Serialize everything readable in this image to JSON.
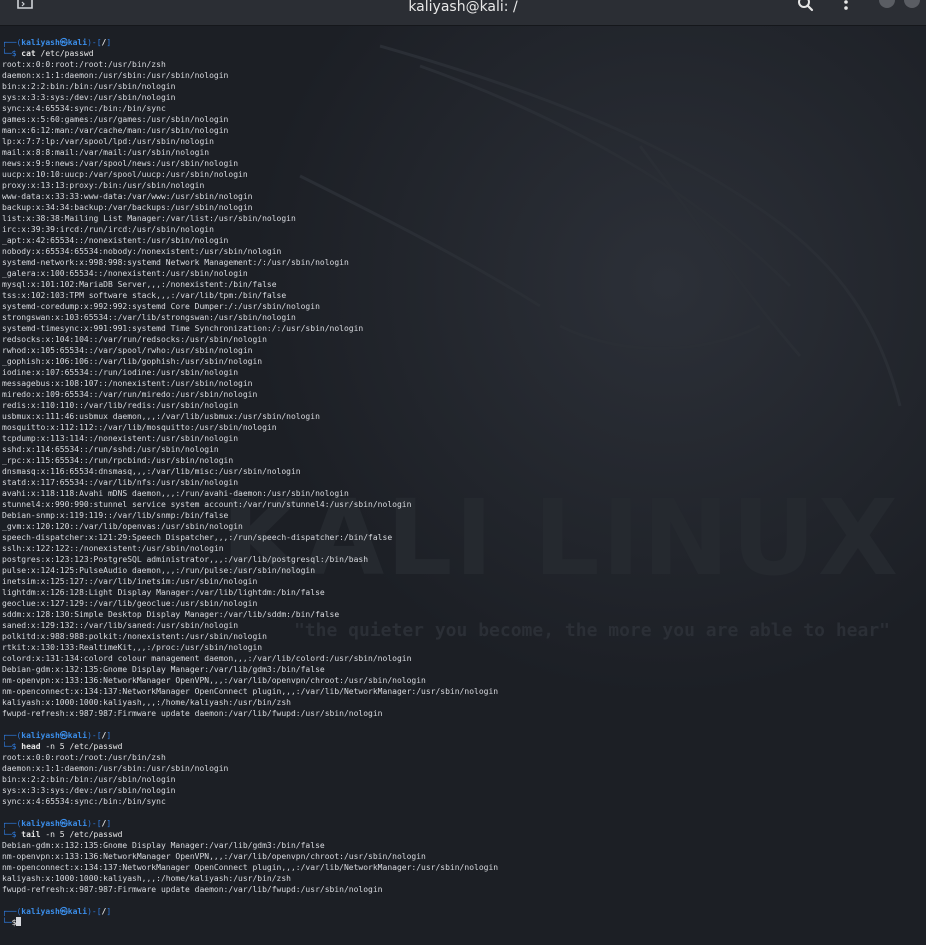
{
  "window": {
    "title": "kaliyash@kali: /",
    "buttons": [
      "search-icon",
      "kebab-menu-icon",
      "minimize",
      "close"
    ]
  },
  "wallpaper": {
    "logo_text": "KALI LINUX",
    "tagline": "\"the quieter you become, the more you are able to hear\""
  },
  "prompt": {
    "user": "kaliyash",
    "symbol": "㉿",
    "host": "kali",
    "cwd": "/"
  },
  "sessions": [
    {
      "command": "cat",
      "args": "/etc/passwd",
      "output": [
        "root:x:0:0:root:/root:/usr/bin/zsh",
        "daemon:x:1:1:daemon:/usr/sbin:/usr/sbin/nologin",
        "bin:x:2:2:bin:/bin:/usr/sbin/nologin",
        "sys:x:3:3:sys:/dev:/usr/sbin/nologin",
        "sync:x:4:65534:sync:/bin:/bin/sync",
        "games:x:5:60:games:/usr/games:/usr/sbin/nologin",
        "man:x:6:12:man:/var/cache/man:/usr/sbin/nologin",
        "lp:x:7:7:lp:/var/spool/lpd:/usr/sbin/nologin",
        "mail:x:8:8:mail:/var/mail:/usr/sbin/nologin",
        "news:x:9:9:news:/var/spool/news:/usr/sbin/nologin",
        "uucp:x:10:10:uucp:/var/spool/uucp:/usr/sbin/nologin",
        "proxy:x:13:13:proxy:/bin:/usr/sbin/nologin",
        "www-data:x:33:33:www-data:/var/www:/usr/sbin/nologin",
        "backup:x:34:34:backup:/var/backups:/usr/sbin/nologin",
        "list:x:38:38:Mailing List Manager:/var/list:/usr/sbin/nologin",
        "irc:x:39:39:ircd:/run/ircd:/usr/sbin/nologin",
        "_apt:x:42:65534::/nonexistent:/usr/sbin/nologin",
        "nobody:x:65534:65534:nobody:/nonexistent:/usr/sbin/nologin",
        "systemd-network:x:998:998:systemd Network Management:/:/usr/sbin/nologin",
        "_galera:x:100:65534::/nonexistent:/usr/sbin/nologin",
        "mysql:x:101:102:MariaDB Server,,,:/nonexistent:/bin/false",
        "tss:x:102:103:TPM software stack,,,:/var/lib/tpm:/bin/false",
        "systemd-coredump:x:992:992:systemd Core Dumper:/:/usr/sbin/nologin",
        "strongswan:x:103:65534::/var/lib/strongswan:/usr/sbin/nologin",
        "systemd-timesync:x:991:991:systemd Time Synchronization:/:/usr/sbin/nologin",
        "redsocks:x:104:104::/var/run/redsocks:/usr/sbin/nologin",
        "rwhod:x:105:65534::/var/spool/rwho:/usr/sbin/nologin",
        "_gophish:x:106:106::/var/lib/gophish:/usr/sbin/nologin",
        "iodine:x:107:65534::/run/iodine:/usr/sbin/nologin",
        "messagebus:x:108:107::/nonexistent:/usr/sbin/nologin",
        "miredo:x:109:65534::/var/run/miredo:/usr/sbin/nologin",
        "redis:x:110:110::/var/lib/redis:/usr/sbin/nologin",
        "usbmux:x:111:46:usbmux daemon,,,:/var/lib/usbmux:/usr/sbin/nologin",
        "mosquitto:x:112:112::/var/lib/mosquitto:/usr/sbin/nologin",
        "tcpdump:x:113:114::/nonexistent:/usr/sbin/nologin",
        "sshd:x:114:65534::/run/sshd:/usr/sbin/nologin",
        "_rpc:x:115:65534::/run/rpcbind:/usr/sbin/nologin",
        "dnsmasq:x:116:65534:dnsmasq,,,:/var/lib/misc:/usr/sbin/nologin",
        "statd:x:117:65534::/var/lib/nfs:/usr/sbin/nologin",
        "avahi:x:118:118:Avahi mDNS daemon,,,:/run/avahi-daemon:/usr/sbin/nologin",
        "stunnel4:x:990:990:stunnel service system account:/var/run/stunnel4:/usr/sbin/nologin",
        "Debian-snmp:x:119:119::/var/lib/snmp:/bin/false",
        "_gvm:x:120:120::/var/lib/openvas:/usr/sbin/nologin",
        "speech-dispatcher:x:121:29:Speech Dispatcher,,,:/run/speech-dispatcher:/bin/false",
        "sslh:x:122:122::/nonexistent:/usr/sbin/nologin",
        "postgres:x:123:123:PostgreSQL administrator,,,:/var/lib/postgresql:/bin/bash",
        "pulse:x:124:125:PulseAudio daemon,,,:/run/pulse:/usr/sbin/nologin",
        "inetsim:x:125:127::/var/lib/inetsim:/usr/sbin/nologin",
        "lightdm:x:126:128:Light Display Manager:/var/lib/lightdm:/bin/false",
        "geoclue:x:127:129::/var/lib/geoclue:/usr/sbin/nologin",
        "sddm:x:128:130:Simple Desktop Display Manager:/var/lib/sddm:/bin/false",
        "saned:x:129:132::/var/lib/saned:/usr/sbin/nologin",
        "polkitd:x:988:988:polkit:/nonexistent:/usr/sbin/nologin",
        "rtkit:x:130:133:RealtimeKit,,,:/proc:/usr/sbin/nologin",
        "colord:x:131:134:colord colour management daemon,,,:/var/lib/colord:/usr/sbin/nologin",
        "Debian-gdm:x:132:135:Gnome Display Manager:/var/lib/gdm3:/bin/false",
        "nm-openvpn:x:133:136:NetworkManager OpenVPN,,,:/var/lib/openvpn/chroot:/usr/sbin/nologin",
        "nm-openconnect:x:134:137:NetworkManager OpenConnect plugin,,,:/var/lib/NetworkManager:/usr/sbin/nologin",
        "kaliyash:x:1000:1000:kaliyash,,,:/home/kaliyash:/usr/bin/zsh",
        "fwupd-refresh:x:987:987:Firmware update daemon:/var/lib/fwupd:/usr/sbin/nologin"
      ]
    },
    {
      "command": "head",
      "args": "-n 5 /etc/passwd",
      "output": [
        "root:x:0:0:root:/root:/usr/bin/zsh",
        "daemon:x:1:1:daemon:/usr/sbin:/usr/sbin/nologin",
        "bin:x:2:2:bin:/bin:/usr/sbin/nologin",
        "sys:x:3:3:sys:/dev:/usr/sbin/nologin",
        "sync:x:4:65534:sync:/bin:/bin/sync"
      ]
    },
    {
      "command": "tail",
      "args": "-n 5 /etc/passwd",
      "output": [
        "Debian-gdm:x:132:135:Gnome Display Manager:/var/lib/gdm3:/bin/false",
        "nm-openvpn:x:133:136:NetworkManager OpenVPN,,,:/var/lib/openvpn/chroot:/usr/sbin/nologin",
        "nm-openconnect:x:134:137:NetworkManager OpenConnect plugin,,,:/var/lib/NetworkManager:/usr/sbin/nologin",
        "kaliyash:x:1000:1000:kaliyash,,,:/home/kaliyash:/usr/bin/zsh",
        "fwupd-refresh:x:987:987:Firmware update daemon:/var/lib/fwupd:/usr/sbin/nologin"
      ]
    }
  ],
  "current_input": "$"
}
